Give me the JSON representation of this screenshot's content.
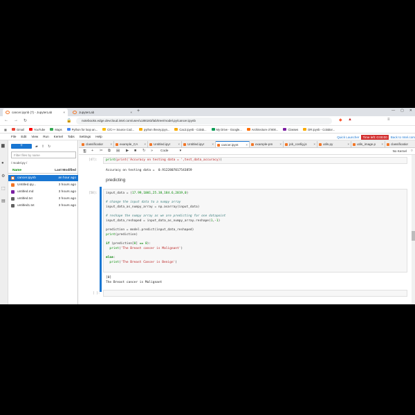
{
  "browser": {
    "tabs": [
      {
        "title": "cancer.ipynb (7) - JupyterLab",
        "close": "×"
      },
      {
        "title": "JupyterLab",
        "close": "×"
      }
    ],
    "new_tab": "+",
    "url": "notebooks.edge.devcloud.intel.com/user/u188183/lab/tree/model.py/cancer.ipynb",
    "bookmarks": [
      {
        "label": "Gmail",
        "color": "#ea4335"
      },
      {
        "label": "YouTube",
        "color": "#ff0000"
      },
      {
        "label": "Maps",
        "color": "#34a853"
      },
      {
        "label": "Python for loop an...",
        "color": "#4285f4"
      },
      {
        "label": "C/C++ Source Cod...",
        "color": "#fbbc05"
      },
      {
        "label": "python theory.ipyn...",
        "color": "#f9ab00"
      },
      {
        "label": "Cac2.ipynb - Colab...",
        "color": "#f9ab00"
      },
      {
        "label": "My Drive - Google...",
        "color": "#0f9d58"
      },
      {
        "label": "Architecture of 800...",
        "color": "#ff6d00"
      },
      {
        "label": "Classes",
        "color": "#7b1fa2"
      },
      {
        "label": "DR.ipynb - Colabor...",
        "color": "#f9ab00"
      }
    ]
  },
  "menu": {
    "items": [
      "File",
      "Edit",
      "View",
      "Run",
      "Kernel",
      "Tabs",
      "Settings",
      "Help"
    ],
    "quick_launcher": "Quick Launcher",
    "time_left": "Time left: 0:00:00",
    "back": "Back to Intel.com"
  },
  "filebrowser": {
    "new_button": "+",
    "filter_placeholder": "Filter files by name",
    "path": "/ model.py /",
    "col_name": "Name",
    "col_modified": "Last Modified",
    "files": [
      {
        "name": "cancer.ipynb",
        "modified": "an hour ago",
        "selected": true,
        "color": "#f37626"
      },
      {
        "name": "Untitled.ipy...",
        "modified": "3 hours ago",
        "selected": false,
        "color": "#f37626"
      },
      {
        "name": "untitled.md",
        "modified": "3 hours ago",
        "selected": false,
        "color": "#7b1fa2"
      },
      {
        "name": "untitled.txt",
        "modified": "3 hours ago",
        "selected": false,
        "color": "#616161"
      },
      {
        "name": "untitled1.txt",
        "modified": "3 hours ago",
        "selected": false,
        "color": "#616161"
      }
    ]
  },
  "nbtabs": [
    {
      "label": "classificatior"
    },
    {
      "label": "example_CA"
    },
    {
      "label": "Untitled.ipyr"
    },
    {
      "label": "Untitled.ipyr"
    },
    {
      "label": "cancer.ipynt",
      "active": true
    },
    {
      "label": "example-pm"
    },
    {
      "label": "job_config.js"
    },
    {
      "label": "utils.py"
    },
    {
      "label": "utils_image.p"
    },
    {
      "label": "classificatior"
    }
  ],
  "toolbar": {
    "cell_type": "Code",
    "kernel": "No Kernel"
  },
  "cells": {
    "c1_prompt": "[47]:",
    "c1_line": "print('Accuracy on testing data = ',test_data_accuracy)",
    "c1_output": "Accuracy on testing data =  0.9122807017543859",
    "md": "predicting",
    "c2_prompt": "[58]:",
    "c2_output1": "[0]",
    "c2_output2": "The Breast cancer is Malignant",
    "c3_prompt": "[ ]:"
  }
}
